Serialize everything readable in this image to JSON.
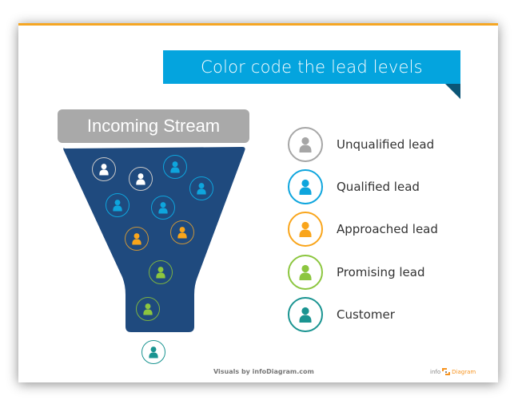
{
  "slide": {
    "title": "Color code the lead levels",
    "stream_label": "Incoming Stream",
    "footer_credit": "Visuals by infoDiagram.com",
    "brand": {
      "prefix": "info",
      "suffix": "Diagram",
      "icon": "infodiagram-logo-icon"
    }
  },
  "colors": {
    "accent_line": "#f5a623",
    "title_banner": "#04a4de",
    "title_fold": "#0b5576",
    "stream_label_bg": "#a9a9a9",
    "funnel": "#1f4a7e"
  },
  "legend": [
    {
      "label": "Unqualified lead",
      "color": "#a6a6a6",
      "icon": "user-icon"
    },
    {
      "label": "Qualified lead",
      "color": "#0ea5dd",
      "icon": "user-icon"
    },
    {
      "label": "Approached lead",
      "color": "#f9a51b",
      "icon": "user-icon"
    },
    {
      "label": "Promising lead",
      "color": "#8cc63f",
      "icon": "user-icon"
    },
    {
      "label": "Customer",
      "color": "#1a9491",
      "icon": "user-icon"
    }
  ],
  "funnel_people": [
    {
      "level": "Unqualified lead",
      "icon": "user-icon"
    },
    {
      "level": "Unqualified lead",
      "icon": "user-icon"
    },
    {
      "level": "Qualified lead",
      "icon": "user-icon"
    },
    {
      "level": "Qualified lead",
      "icon": "user-icon"
    },
    {
      "level": "Qualified lead",
      "icon": "user-icon"
    },
    {
      "level": "Qualified lead",
      "icon": "user-icon"
    },
    {
      "level": "Approached lead",
      "icon": "user-icon"
    },
    {
      "level": "Approached lead",
      "icon": "user-icon"
    },
    {
      "level": "Promising lead",
      "icon": "user-icon"
    },
    {
      "level": "Promising lead",
      "icon": "user-icon"
    },
    {
      "level": "Customer",
      "icon": "user-icon"
    }
  ]
}
